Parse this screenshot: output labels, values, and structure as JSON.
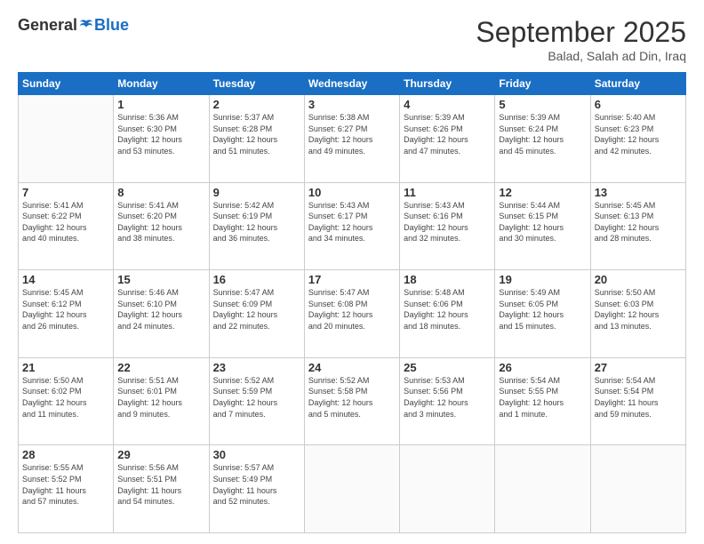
{
  "header": {
    "logo_general": "General",
    "logo_blue": "Blue",
    "month": "September 2025",
    "location": "Balad, Salah ad Din, Iraq"
  },
  "weekdays": [
    "Sunday",
    "Monday",
    "Tuesday",
    "Wednesday",
    "Thursday",
    "Friday",
    "Saturday"
  ],
  "weeks": [
    [
      {
        "day": "",
        "text": ""
      },
      {
        "day": "1",
        "text": "Sunrise: 5:36 AM\nSunset: 6:30 PM\nDaylight: 12 hours\nand 53 minutes."
      },
      {
        "day": "2",
        "text": "Sunrise: 5:37 AM\nSunset: 6:28 PM\nDaylight: 12 hours\nand 51 minutes."
      },
      {
        "day": "3",
        "text": "Sunrise: 5:38 AM\nSunset: 6:27 PM\nDaylight: 12 hours\nand 49 minutes."
      },
      {
        "day": "4",
        "text": "Sunrise: 5:39 AM\nSunset: 6:26 PM\nDaylight: 12 hours\nand 47 minutes."
      },
      {
        "day": "5",
        "text": "Sunrise: 5:39 AM\nSunset: 6:24 PM\nDaylight: 12 hours\nand 45 minutes."
      },
      {
        "day": "6",
        "text": "Sunrise: 5:40 AM\nSunset: 6:23 PM\nDaylight: 12 hours\nand 42 minutes."
      }
    ],
    [
      {
        "day": "7",
        "text": "Sunrise: 5:41 AM\nSunset: 6:22 PM\nDaylight: 12 hours\nand 40 minutes."
      },
      {
        "day": "8",
        "text": "Sunrise: 5:41 AM\nSunset: 6:20 PM\nDaylight: 12 hours\nand 38 minutes."
      },
      {
        "day": "9",
        "text": "Sunrise: 5:42 AM\nSunset: 6:19 PM\nDaylight: 12 hours\nand 36 minutes."
      },
      {
        "day": "10",
        "text": "Sunrise: 5:43 AM\nSunset: 6:17 PM\nDaylight: 12 hours\nand 34 minutes."
      },
      {
        "day": "11",
        "text": "Sunrise: 5:43 AM\nSunset: 6:16 PM\nDaylight: 12 hours\nand 32 minutes."
      },
      {
        "day": "12",
        "text": "Sunrise: 5:44 AM\nSunset: 6:15 PM\nDaylight: 12 hours\nand 30 minutes."
      },
      {
        "day": "13",
        "text": "Sunrise: 5:45 AM\nSunset: 6:13 PM\nDaylight: 12 hours\nand 28 minutes."
      }
    ],
    [
      {
        "day": "14",
        "text": "Sunrise: 5:45 AM\nSunset: 6:12 PM\nDaylight: 12 hours\nand 26 minutes."
      },
      {
        "day": "15",
        "text": "Sunrise: 5:46 AM\nSunset: 6:10 PM\nDaylight: 12 hours\nand 24 minutes."
      },
      {
        "day": "16",
        "text": "Sunrise: 5:47 AM\nSunset: 6:09 PM\nDaylight: 12 hours\nand 22 minutes."
      },
      {
        "day": "17",
        "text": "Sunrise: 5:47 AM\nSunset: 6:08 PM\nDaylight: 12 hours\nand 20 minutes."
      },
      {
        "day": "18",
        "text": "Sunrise: 5:48 AM\nSunset: 6:06 PM\nDaylight: 12 hours\nand 18 minutes."
      },
      {
        "day": "19",
        "text": "Sunrise: 5:49 AM\nSunset: 6:05 PM\nDaylight: 12 hours\nand 15 minutes."
      },
      {
        "day": "20",
        "text": "Sunrise: 5:50 AM\nSunset: 6:03 PM\nDaylight: 12 hours\nand 13 minutes."
      }
    ],
    [
      {
        "day": "21",
        "text": "Sunrise: 5:50 AM\nSunset: 6:02 PM\nDaylight: 12 hours\nand 11 minutes."
      },
      {
        "day": "22",
        "text": "Sunrise: 5:51 AM\nSunset: 6:01 PM\nDaylight: 12 hours\nand 9 minutes."
      },
      {
        "day": "23",
        "text": "Sunrise: 5:52 AM\nSunset: 5:59 PM\nDaylight: 12 hours\nand 7 minutes."
      },
      {
        "day": "24",
        "text": "Sunrise: 5:52 AM\nSunset: 5:58 PM\nDaylight: 12 hours\nand 5 minutes."
      },
      {
        "day": "25",
        "text": "Sunrise: 5:53 AM\nSunset: 5:56 PM\nDaylight: 12 hours\nand 3 minutes."
      },
      {
        "day": "26",
        "text": "Sunrise: 5:54 AM\nSunset: 5:55 PM\nDaylight: 12 hours\nand 1 minute."
      },
      {
        "day": "27",
        "text": "Sunrise: 5:54 AM\nSunset: 5:54 PM\nDaylight: 11 hours\nand 59 minutes."
      }
    ],
    [
      {
        "day": "28",
        "text": "Sunrise: 5:55 AM\nSunset: 5:52 PM\nDaylight: 11 hours\nand 57 minutes."
      },
      {
        "day": "29",
        "text": "Sunrise: 5:56 AM\nSunset: 5:51 PM\nDaylight: 11 hours\nand 54 minutes."
      },
      {
        "day": "30",
        "text": "Sunrise: 5:57 AM\nSunset: 5:49 PM\nDaylight: 11 hours\nand 52 minutes."
      },
      {
        "day": "",
        "text": ""
      },
      {
        "day": "",
        "text": ""
      },
      {
        "day": "",
        "text": ""
      },
      {
        "day": "",
        "text": ""
      }
    ]
  ]
}
